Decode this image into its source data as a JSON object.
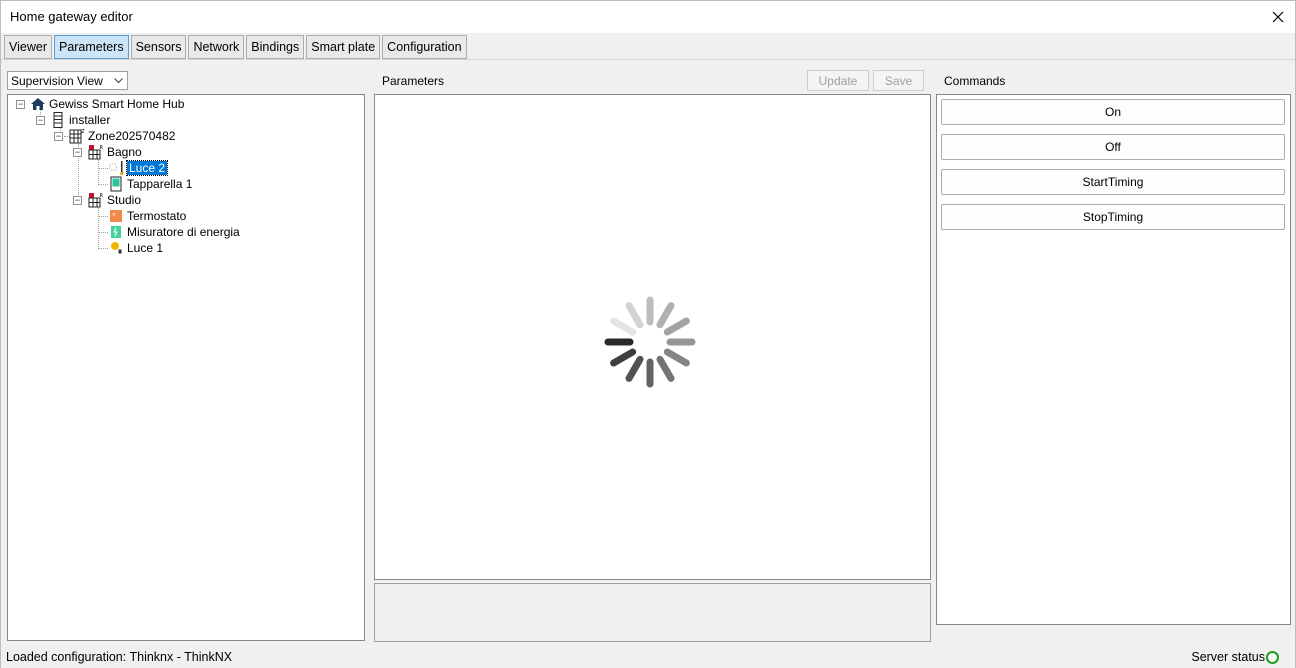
{
  "window": {
    "title": "Home gateway editor"
  },
  "tabs": [
    {
      "label": "Viewer"
    },
    {
      "label": "Parameters"
    },
    {
      "label": "Sensors"
    },
    {
      "label": "Network"
    },
    {
      "label": "Bindings"
    },
    {
      "label": "Smart plate"
    },
    {
      "label": "Configuration"
    }
  ],
  "active_tab": "Parameters",
  "view_selector": {
    "value": "Supervision View"
  },
  "tree": {
    "root": "Gewiss Smart Home Hub",
    "user": "installer",
    "zone": "Zone202570482",
    "rooms": [
      {
        "label": "Bagno",
        "devices": [
          "Luce 2",
          "Tapparella 1"
        ]
      },
      {
        "label": "Studio",
        "devices": [
          "Termostato",
          "Misuratore di energia",
          "Luce 1"
        ]
      }
    ],
    "selected": "Luce 2"
  },
  "parameters": {
    "header": "Parameters",
    "update_label": "Update",
    "save_label": "Save",
    "loading": true
  },
  "commands": {
    "header": "Commands",
    "buttons": [
      "On",
      "Off",
      "StartTiming",
      "StopTiming"
    ]
  },
  "statusbar": {
    "loaded_configuration": "Loaded configuration: Thinknx - ThinkNX",
    "server_status_label": "Server status",
    "server_status_color": "#1aa01a"
  },
  "colors": {
    "active_tab": "#cce4f7",
    "selection": "#0078d7"
  }
}
